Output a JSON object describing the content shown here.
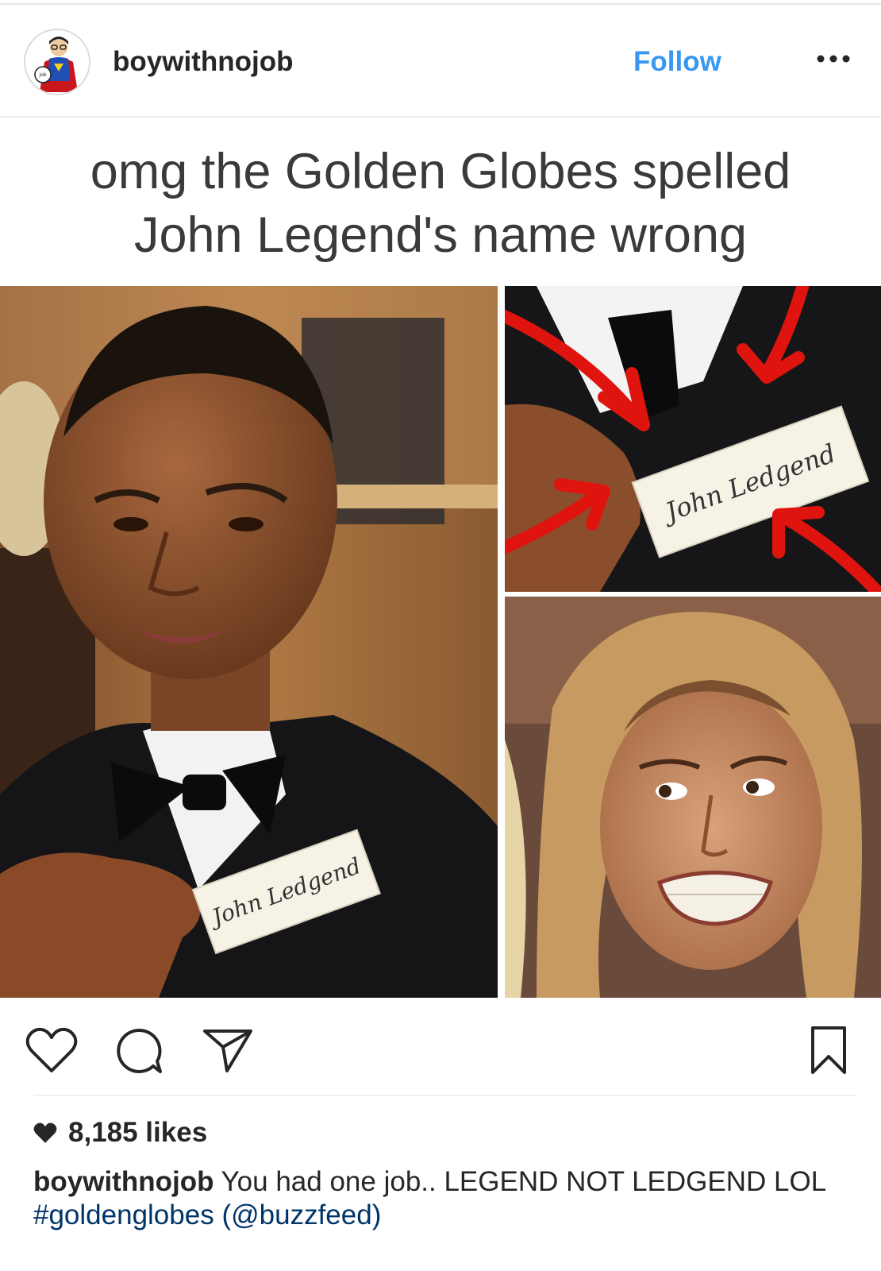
{
  "header": {
    "username": "boywithnojob",
    "follow_label": "Follow",
    "more_icon": "ellipsis-icon"
  },
  "post": {
    "meme_caption_line1": "omg the Golden Globes spelled",
    "meme_caption_line2": "John Legend's name wrong",
    "card_text": "John Ledgend",
    "arrow_color": "#e0140f"
  },
  "actions": {
    "like_icon": "heart-icon",
    "comment_icon": "comment-icon",
    "share_icon": "paper-plane-icon",
    "save_icon": "bookmark-icon"
  },
  "likes": {
    "count_label": "8,185 likes"
  },
  "caption": {
    "username": "boywithnojob",
    "text": "You had one job.. LEGEND NOT LEDGEND LOL",
    "hashtag": "#goldenglobes",
    "mention": "(@buzzfeed)"
  },
  "colors": {
    "link_blue": "#3897f0",
    "text_dark": "#262626",
    "hashtag_blue": "#003569"
  }
}
